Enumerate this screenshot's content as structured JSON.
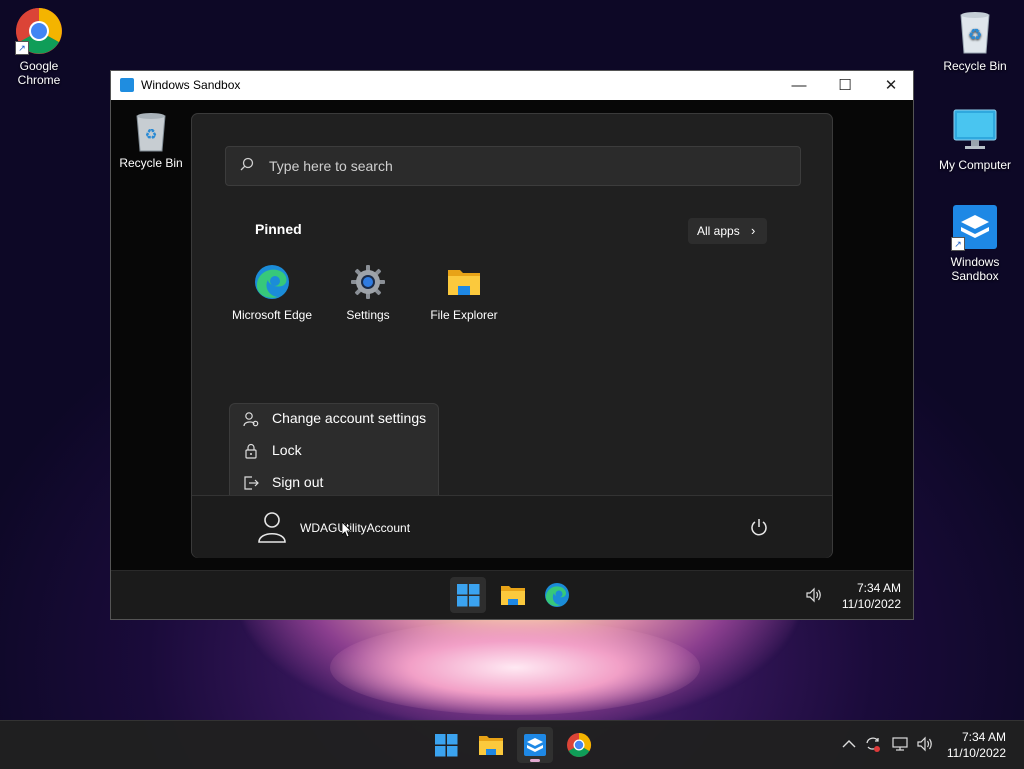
{
  "desktop": {
    "icons": [
      {
        "label_line1": "Google",
        "label_line2": "Chrome",
        "icon": "chrome-icon"
      },
      {
        "label_line1": "Recycle Bin",
        "icon": "recycle-bin-icon"
      },
      {
        "label_line1": "My Computer",
        "icon": "computer-icon"
      },
      {
        "label_line1": "Windows",
        "label_line2": "Sandbox",
        "icon": "windows-sandbox-icon"
      }
    ]
  },
  "sandbox_window": {
    "title": "Windows Sandbox",
    "inner_desktop_icon": "Recycle Bin",
    "start_menu": {
      "search_placeholder": "Type here to search",
      "pinned_heading": "Pinned",
      "all_apps_label": "All apps",
      "pinned_apps": [
        {
          "label": "Microsoft Edge",
          "icon": "edge-icon"
        },
        {
          "label": "Settings",
          "icon": "settings-gear-icon"
        },
        {
          "label": "File Explorer",
          "icon": "folder-icon"
        }
      ],
      "account_menu": [
        {
          "label": "Change account settings",
          "icon": "account-settings-icon"
        },
        {
          "label": "Lock",
          "icon": "lock-icon"
        },
        {
          "label": "Sign out",
          "icon": "sign-out-icon"
        }
      ],
      "user_name": "WDAGUtilityAccount"
    },
    "taskbar": {
      "time": "7:34 AM",
      "date": "11/10/2022"
    }
  },
  "taskbar": {
    "time": "7:34 AM",
    "date": "11/10/2022"
  },
  "colors": {
    "accent": "#0078d4",
    "start_menu_bg": "#202020",
    "taskbar_bg": "#202020",
    "active_indicator": "#e1a8d0"
  }
}
